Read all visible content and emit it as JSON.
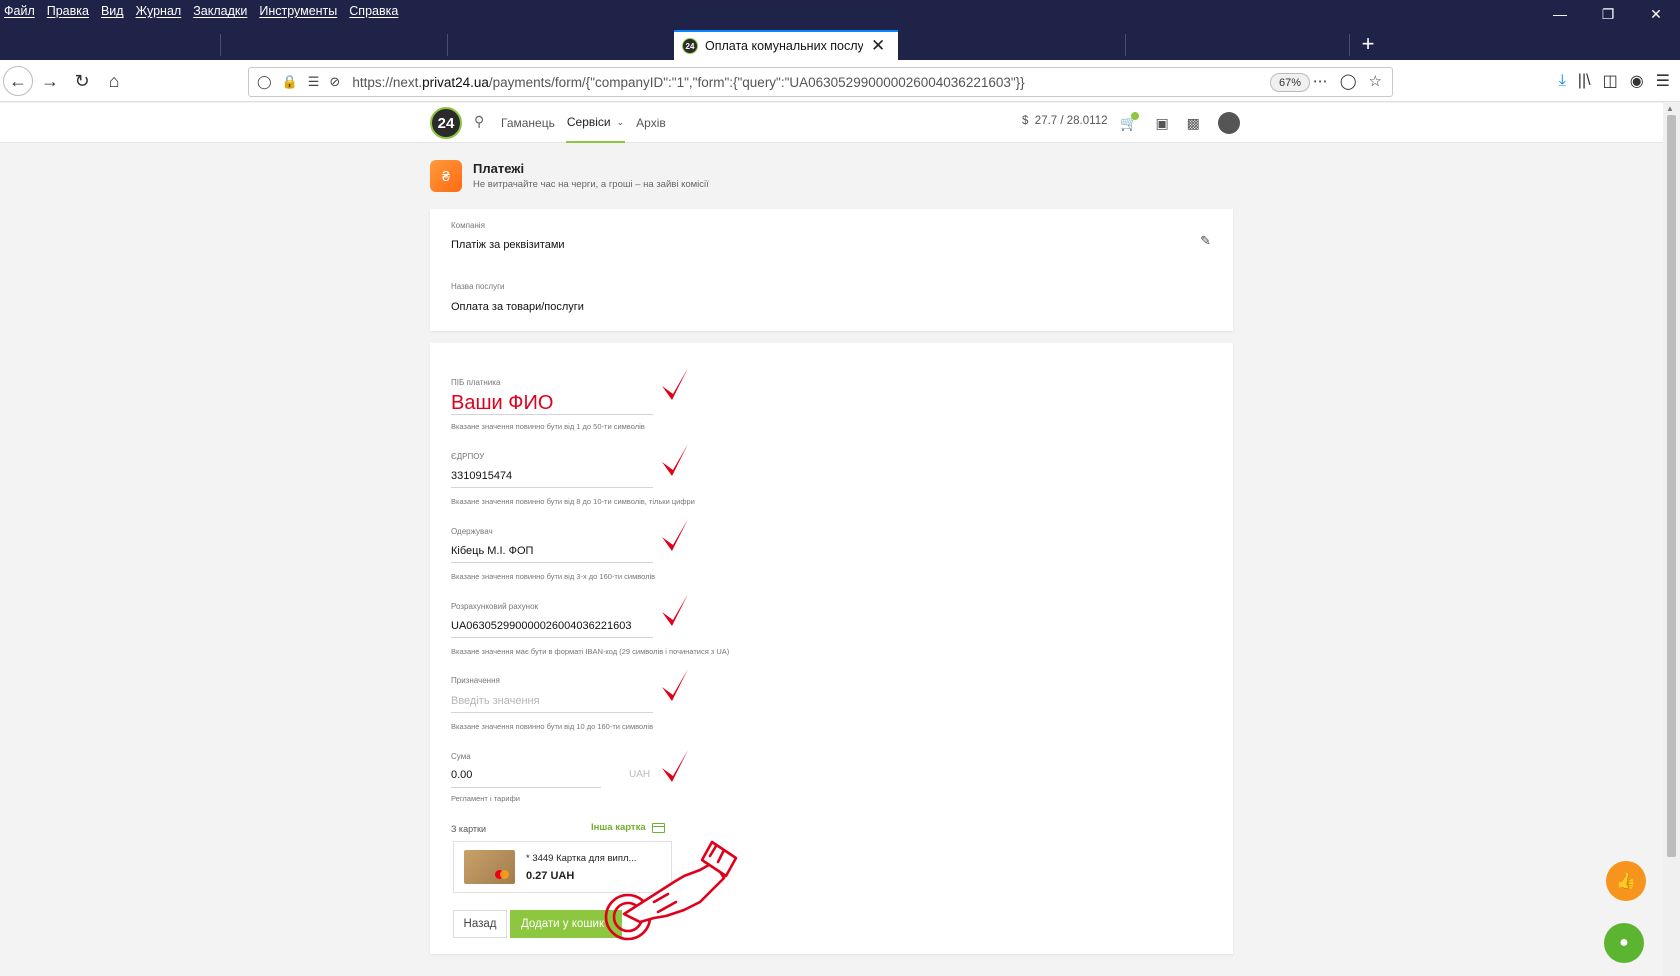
{
  "menu": [
    "Файл",
    "Правка",
    "Вид",
    "Журнал",
    "Закладки",
    "Инструменты",
    "Справка"
  ],
  "browser": {
    "tab_title": "Оплата комунальних послуг",
    "favicon_text": "24",
    "url_prefix": "https://next.",
    "url_domain": "privat24.ua",
    "url_path": "/payments/form/{\"companyID\":\"1\",\"form\":{\"query\":\"UA063052990000026004036221603\"}}",
    "zoom": "67%"
  },
  "site": {
    "logo": "24",
    "nav": [
      "Гаманець",
      "Сервіси",
      "Архів"
    ],
    "active_nav": "Сервіси",
    "rate_symbol": "$",
    "rate": "27.7 / 28.0112"
  },
  "payments": {
    "icon": "₴",
    "title": "Платежі",
    "subtitle": "Не витрачайте час на черги, а гроші – на зайві комісії"
  },
  "company_card": {
    "company_label": "Компанія",
    "company_value": "Платіж за реквізитами",
    "service_label": "Назва послуги",
    "service_value": "Оплата за товари/послуги"
  },
  "form": {
    "payer": {
      "label": "ПІБ платника",
      "value": "Ваши ФИО",
      "hint": "Вказане значення повинно бути від 1 до 50-ти символів"
    },
    "edrpou": {
      "label": "ЄДРПОУ",
      "value": "3310915474",
      "hint": "Вказане значення повинно бути від 8 до 10-ти символів, тільки цифри"
    },
    "recipient": {
      "label": "Одержувач",
      "value": "Кібець М.І. ФОП",
      "hint": "Вказане значення повинно бути від 3-х до 160-ти символів"
    },
    "account": {
      "label": "Розрахунковий рахунок",
      "value": "UA063052990000026004036221603",
      "hint": "Вказане значення має бути в форматі IBAN-код (29 символів і починатися з UA)"
    },
    "purpose": {
      "label": "Призначення",
      "placeholder": "Введіть значення",
      "hint": "Вказане значення повинно бути від 10 до 160-ти символів"
    },
    "amount": {
      "label": "Сума",
      "value": "0.00",
      "currency": "UAH",
      "hint": "Регламент і тарифи"
    },
    "from_card_label": "З картки",
    "other_card": "Інша картка",
    "card_name": "* 3449  Картка для випл...",
    "card_balance": "0.27 UAH",
    "back_button": "Назад",
    "add_button": "Додати у кошик"
  },
  "colors": {
    "accent_green": "#8dc63f",
    "annotation_red": "#e0001b",
    "chrome_dark": "#1f2347",
    "like_orange": "#f7941d"
  }
}
